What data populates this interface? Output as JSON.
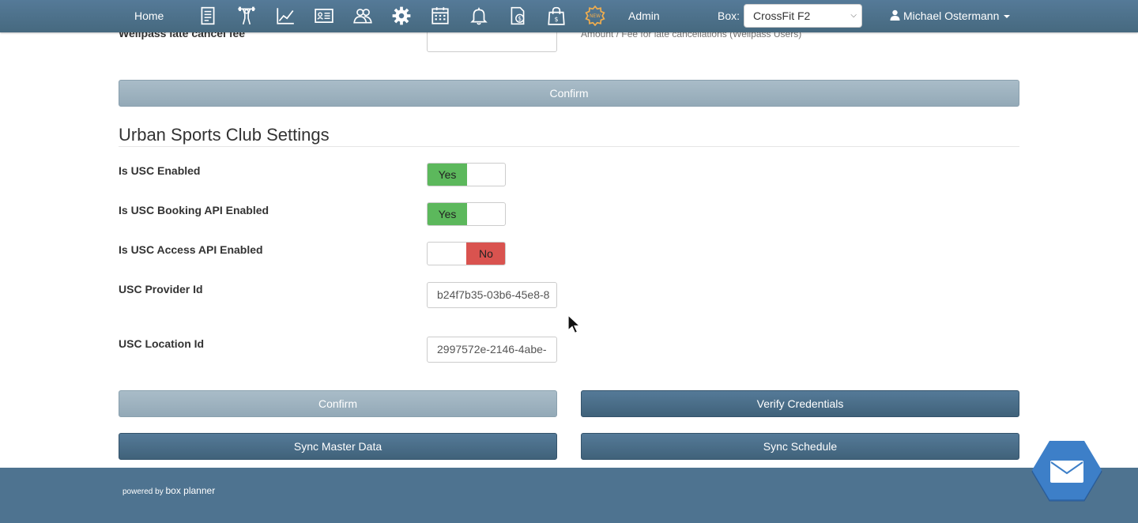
{
  "nav": {
    "home": "Home",
    "admin": "Admin",
    "box_label": "Box:",
    "box_value": "CrossFit F2",
    "user": "Michael Ostermann",
    "icons": [
      "documents-icon",
      "athlete-icon",
      "chart-icon",
      "id-card-icon",
      "members-icon",
      "settings-gear-icon",
      "calendar-icon",
      "bell-icon",
      "invoice-icon",
      "shop-bag-icon",
      "new-badge-icon"
    ]
  },
  "wellpass": {
    "label": "Wellpass late cancel fee",
    "help": "Amount / Fee for late cancellations (Wellpass Users)",
    "value": "",
    "confirm": "Confirm"
  },
  "usc": {
    "title": "Urban Sports Club Settings",
    "enabled_label": "Is USC Enabled",
    "enabled_value": "Yes",
    "booking_label": "Is USC Booking API Enabled",
    "booking_value": "Yes",
    "access_label": "Is USC Access API Enabled",
    "access_value": "No",
    "provider_label": "USC Provider Id",
    "provider_value": "b24f7b35-03b6-45e8-8",
    "location_label": "USC Location Id",
    "location_value": "2997572e-2146-4abe-",
    "confirm": "Confirm",
    "verify": "Verify Credentials",
    "sync_master": "Sync Master Data",
    "sync_schedule": "Sync Schedule"
  },
  "footer": {
    "powered_by": "powered by",
    "brand": "box planner"
  },
  "colors": {
    "navbar": "#4b6f8c",
    "yes": "#5cb85c",
    "no": "#d9534f",
    "button_dark": "#4a6d87",
    "button_light": "#9fb3c0"
  }
}
